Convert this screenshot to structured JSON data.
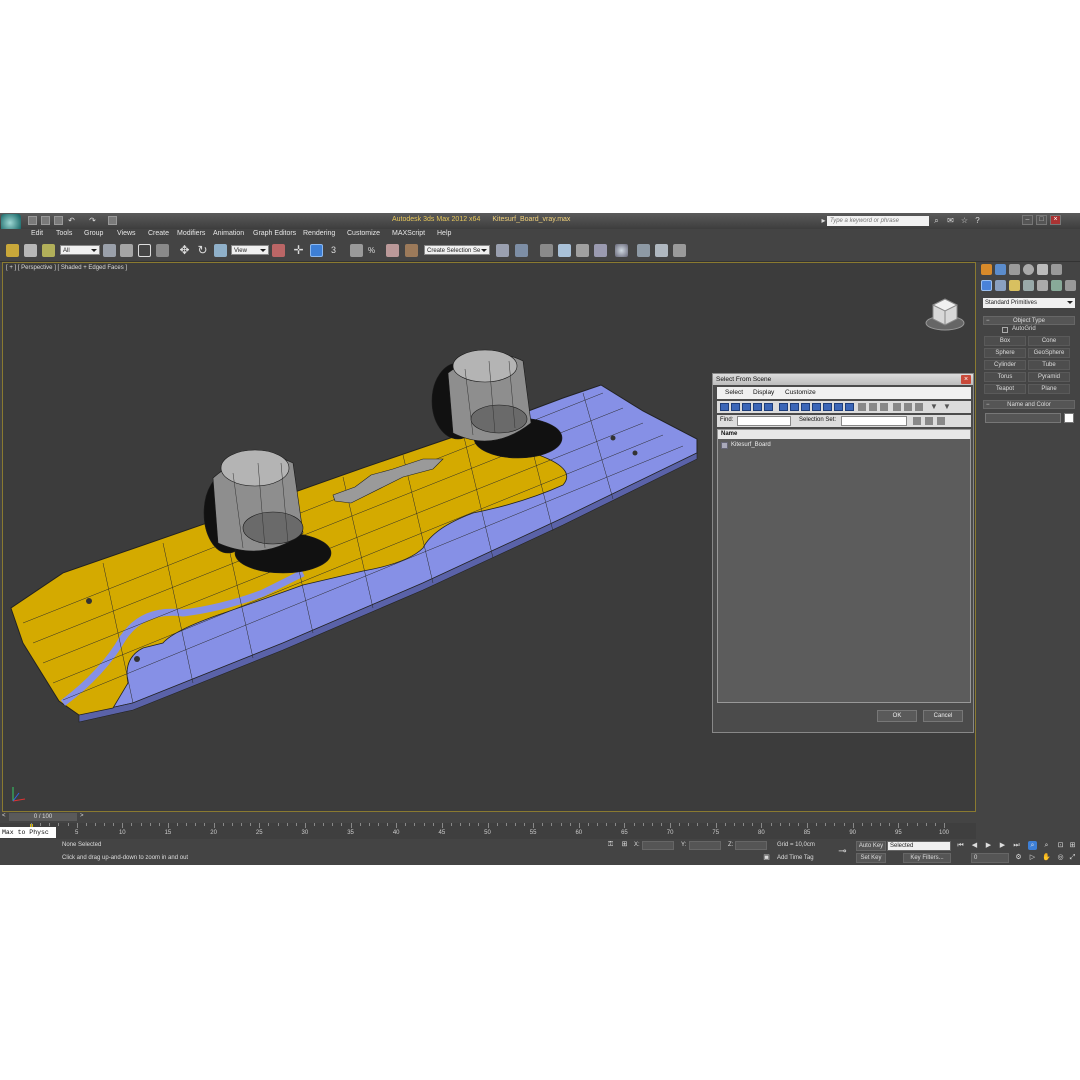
{
  "window": {
    "app_title": "Autodesk 3ds Max 2012 x64",
    "file_name": "Kitesurf_Board_vray.max",
    "search_placeholder": "Type a keyword or phrase"
  },
  "menu": [
    "Edit",
    "Tools",
    "Group",
    "Views",
    "Create",
    "Modifiers",
    "Animation",
    "Graph Editors",
    "Rendering",
    "Customize",
    "MAXScript",
    "Help"
  ],
  "toolbar": {
    "filter": "All",
    "ref_coord": "View",
    "selection_set": "Create Selection Se"
  },
  "viewport": {
    "label": "[ + ] [ Perspective ] [ Shaded + Edged Faces ]"
  },
  "command_panel": {
    "category": "Standard Primitives",
    "object_type_title": "Object Type",
    "autogrid": "AutoGrid",
    "primitives": [
      "Box",
      "Cone",
      "Sphere",
      "GeoSphere",
      "Cylinder",
      "Tube",
      "Torus",
      "Pyramid",
      "Teapot",
      "Plane"
    ],
    "name_color_title": "Name and Color"
  },
  "dialog": {
    "title": "Select From Scene",
    "menu": [
      "Select",
      "Display",
      "Customize"
    ],
    "find_label": "Find:",
    "selection_set_label": "Selection Set:",
    "column_name": "Name",
    "objects": [
      "Kitesurf_Board"
    ],
    "ok": "OK",
    "cancel": "Cancel"
  },
  "timeline": {
    "slider": "0 / 100",
    "ticks": [
      5,
      10,
      15,
      20,
      25,
      30,
      35,
      40,
      45,
      50,
      55,
      60,
      65,
      70,
      75,
      80,
      85,
      90,
      95,
      100
    ]
  },
  "status": {
    "maxscript": "Max to Physc",
    "selection": "None Selected",
    "prompt": "Click and drag up-and-down to zoom in and out",
    "x_label": "X:",
    "y_label": "Y:",
    "z_label": "Z:",
    "grid": "Grid = 10,0cm",
    "add_time_tag": "Add Time Tag",
    "auto_key": "Auto Key",
    "key_mode": "Selected",
    "set_key": "Set Key",
    "key_filters": "Key Filters...",
    "frame": "0"
  },
  "colors": {
    "board_yellow": "#d4aa00",
    "board_blue": "#8690e6",
    "viewport_bg": "#3c3c3c",
    "ui_bg": "#444444"
  }
}
